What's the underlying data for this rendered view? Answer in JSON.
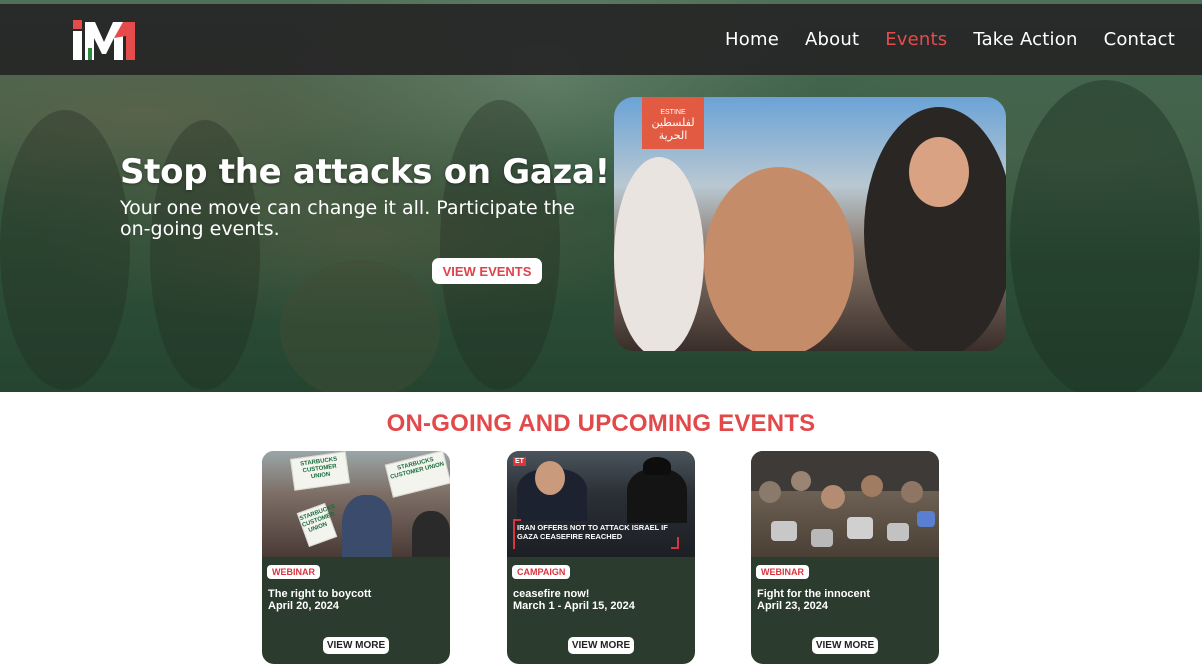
{
  "nav": {
    "logo_text": "IM",
    "links": [
      {
        "label": "Home",
        "active": false
      },
      {
        "label": "About",
        "active": false
      },
      {
        "label": "Events",
        "active": true
      },
      {
        "label": "Take Action",
        "active": false
      },
      {
        "label": "Contact",
        "active": false
      }
    ],
    "active_color": "#e64b4b"
  },
  "hero": {
    "title": "Stop the attacks on Gaza!",
    "subtitle": "Your one move can change it all. Participate the on-going events.",
    "button_label": "VIEW EVENTS",
    "photo_sign_text": "لفلسطين الحرية",
    "photo_sign_top": "ESTINE"
  },
  "events": {
    "heading": "ON-GOING AND UPCOMING EVENTS",
    "accent_color": "#e2494a",
    "cards": [
      {
        "badge": "WEBINAR",
        "title": "The right to boycott",
        "date": "April 20, 2024",
        "button_label": "VIEW MORE",
        "thumb_signs": [
          "STARBUCKS CUSTOMER UNION",
          "STARBUCKS CUSTOMER UNION",
          "STARBUCKS CUSTOMER UNION"
        ]
      },
      {
        "badge": "CAMPAIGN",
        "title": "ceasefire now!",
        "date": "March 1 - April 15, 2024",
        "button_label": "VIEW MORE",
        "thumb_brand": "ET",
        "thumb_caption": "IRAN OFFERS NOT TO ATTACK ISRAEL IF GAZA CEASEFIRE REACHED"
      },
      {
        "badge": "WEBINAR",
        "title": "Fight for the innocent",
        "date": "April 23, 2024",
        "button_label": "VIEW MORE"
      }
    ]
  }
}
